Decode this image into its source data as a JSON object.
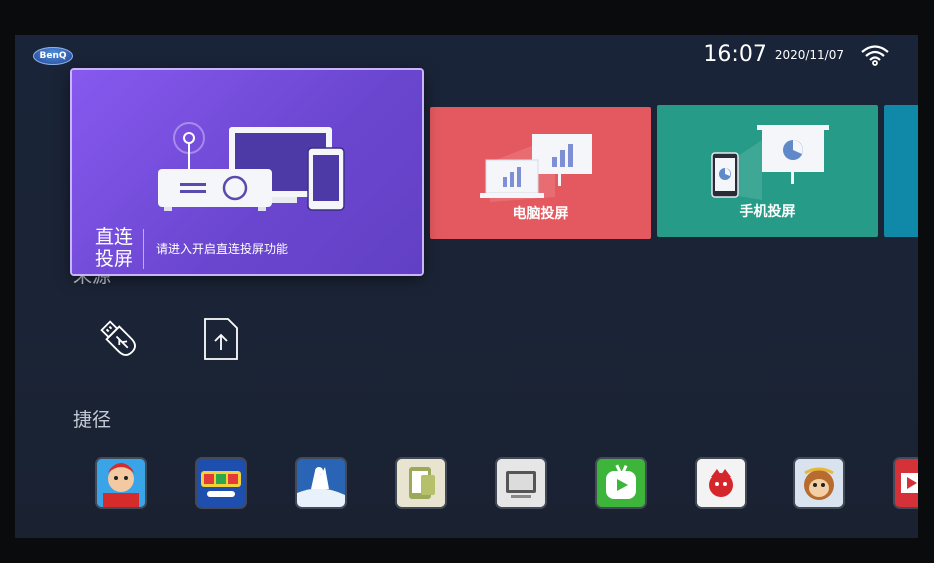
{
  "brand": {
    "logo": "BenQ"
  },
  "status": {
    "time": "16:07",
    "date": "2020/11/07",
    "wifi_icon": "wifi-icon"
  },
  "tiles": {
    "direct": {
      "title_line1": "直连",
      "title_line2": "投屏",
      "description": "请进入开启直连投屏功能"
    },
    "pc": {
      "label": "电脑投屏"
    },
    "phone": {
      "label": "手机投屏"
    }
  },
  "sections": {
    "source_partial": "来源",
    "shortcuts": "捷径"
  },
  "source_items": [
    "usb-icon",
    "upload-file-icon"
  ],
  "apps": [
    "game-app-icon",
    "kids-app-icon",
    "video-app-icon",
    "screen-share-app-icon",
    "media-app-icon",
    "player-app-icon",
    "benchmark-app-icon",
    "cartoon-app-icon",
    "play-app-icon"
  ],
  "colors": {
    "direct_tile": "#7a50e3",
    "pc_tile": "#e45960",
    "phone_tile": "#259b88",
    "extra_tile": "#1089a8"
  }
}
